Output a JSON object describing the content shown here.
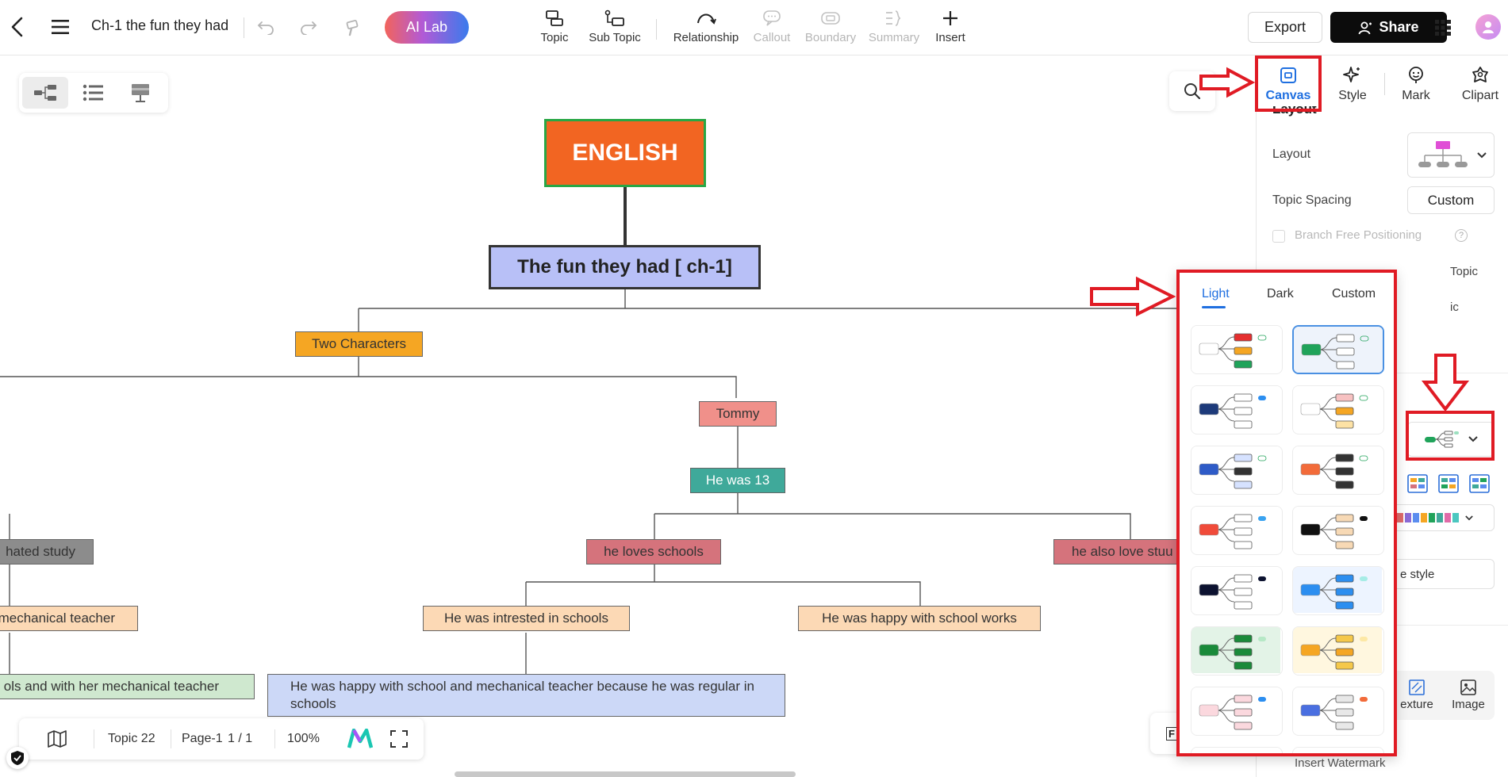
{
  "app": {
    "title": "Ch-1 the fun they had",
    "ai_lab": "AI Lab"
  },
  "toolbar": {
    "tools": [
      {
        "label": "Topic",
        "icon": "topic-icon",
        "enabled": true
      },
      {
        "label": "Sub Topic",
        "icon": "subtopic-icon",
        "enabled": true
      },
      {
        "label": "Relationship",
        "icon": "relationship-icon",
        "enabled": true
      },
      {
        "label": "Callout",
        "icon": "callout-icon",
        "enabled": false
      },
      {
        "label": "Boundary",
        "icon": "boundary-icon",
        "enabled": false
      },
      {
        "label": "Summary",
        "icon": "summary-icon",
        "enabled": false
      },
      {
        "label": "Insert",
        "icon": "plus-icon",
        "enabled": true
      }
    ],
    "export_label": "Export",
    "share_label": "Share"
  },
  "mindmap": {
    "root": "ENGLISH",
    "main": "The fun they had [ ch-1]",
    "nodes": [
      {
        "id": "two",
        "text": "Two Characters",
        "color": "#f5a623"
      },
      {
        "id": "tommy",
        "text": "Tommy",
        "color": "#f0908a"
      },
      {
        "id": "hewas13",
        "text": "He was 13",
        "color": "#3fa99a"
      },
      {
        "id": "hated",
        "text": "hated study",
        "color": "#8c8c8c"
      },
      {
        "id": "loves",
        "text": "he loves schools",
        "color": "#d5737c"
      },
      {
        "id": "alsolove",
        "text": "he also love stuu",
        "color": "#d5737c"
      },
      {
        "id": "mech",
        "text": "mechanical teacher",
        "color": "#fcd9b5"
      },
      {
        "id": "intrested",
        "text": "He was intrested in schools",
        "color": "#fcd9b5"
      },
      {
        "id": "happywork",
        "text": "He was happy with school works",
        "color": "#fcd9b5"
      },
      {
        "id": "ols",
        "text": "ols and with her mechanical teacher",
        "color": "#cfe8cf"
      },
      {
        "id": "happymech",
        "text": "He was happy with school and mechanical teacher because he was regular in schools",
        "color": "#ccd8f7"
      }
    ]
  },
  "bottom_bar": {
    "topic_count": "Topic 22",
    "page_label": "Page-1",
    "page_index": "1 / 1",
    "zoom": "100%"
  },
  "right_panel": {
    "tabs": [
      {
        "label": "Canvas",
        "icon": "canvas-icon",
        "active": true
      },
      {
        "label": "Style",
        "icon": "style-icon",
        "active": false
      },
      {
        "label": "Mark",
        "icon": "mark-icon",
        "active": false
      },
      {
        "label": "Clipart",
        "icon": "clipart-icon",
        "active": false
      }
    ],
    "section_title": "Layout",
    "layout_label": "Layout",
    "topic_spacing_label": "Topic Spacing",
    "topic_spacing_value": "Custom",
    "branch_free_label": "Branch Free Positioning",
    "floating_label": "Topic",
    "partial_ic": "ic",
    "style_btn_partial": "e style",
    "texture_label": "exture",
    "image_label": "Image",
    "watermark_partial": "Insert Watermark"
  },
  "theme_popup": {
    "tabs": [
      "Light",
      "Dark",
      "Custom"
    ],
    "active_tab": "Light",
    "selected_index": 1,
    "theme_count": 16
  },
  "colors": {
    "accent": "#1f6fe0",
    "annotation_red": "#e01b24",
    "root_fill": "#f26522",
    "root_border": "#28a745",
    "main_fill": "#b8c0f7"
  }
}
